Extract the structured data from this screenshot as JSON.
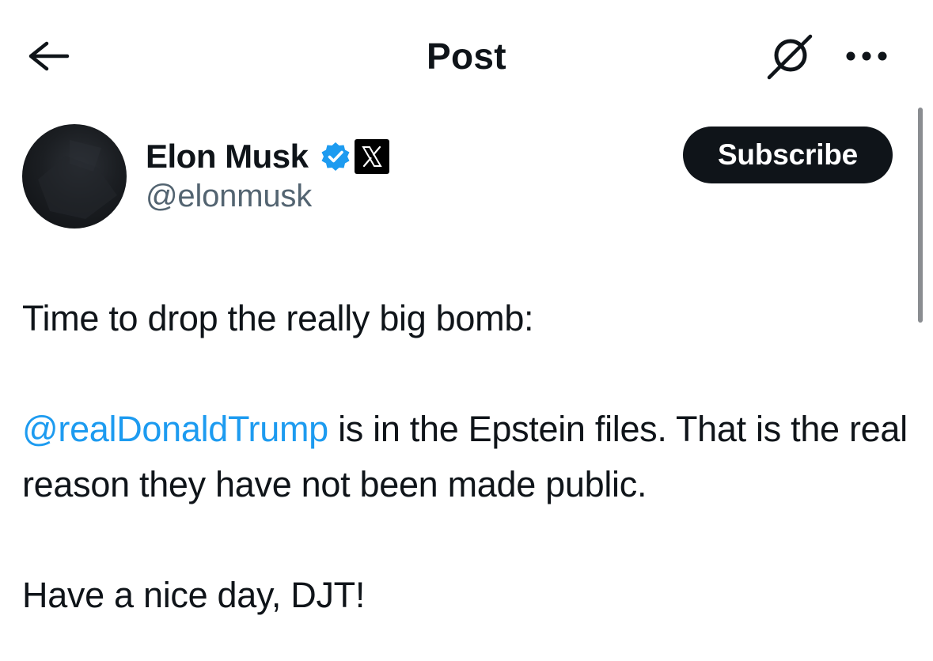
{
  "header": {
    "title": "Post",
    "back_icon": "arrow-left-icon",
    "grok_icon": "grok-icon",
    "more_icon": "more-horizontal-icon"
  },
  "author": {
    "name": "Elon Musk",
    "handle": "@elonmusk",
    "verified_icon": "verified-badge-icon",
    "affiliation_icon": "x-logo-icon",
    "subscribe_label": "Subscribe"
  },
  "tweet": {
    "line1": "Time to drop the really big bomb:",
    "mention": "@realDonaldTrump",
    "line2_rest": " is in the Epstein files. That is the real reason they have not been made public.",
    "line3": "Have a nice day, DJT!"
  },
  "colors": {
    "text": "#0f1419",
    "secondary_text": "#536471",
    "link": "#1d9bf0",
    "verified": "#1d9bf0",
    "button_bg": "#0f1419"
  }
}
